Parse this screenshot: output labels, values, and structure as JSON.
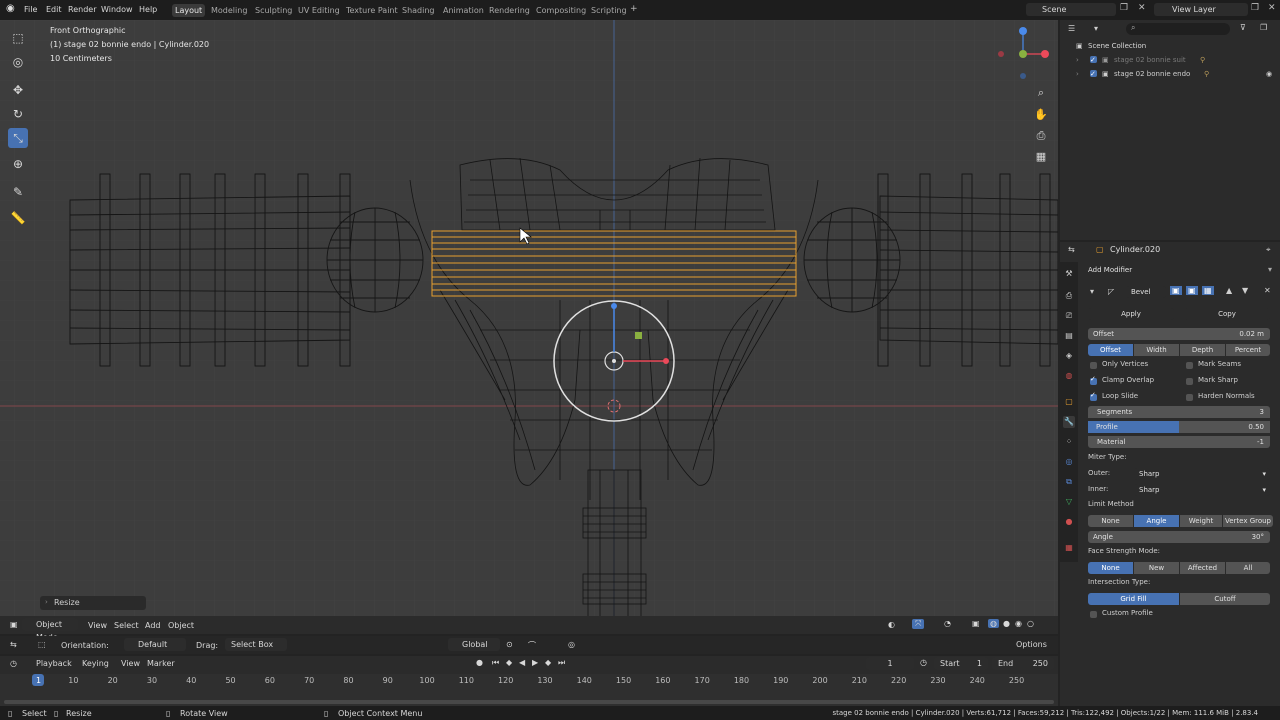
{
  "menu": [
    "File",
    "Edit",
    "Render",
    "Window",
    "Help"
  ],
  "workspaces": [
    "Layout",
    "Modeling",
    "Sculpting",
    "UV Editing",
    "Texture Paint",
    "Shading",
    "Animation",
    "Rendering",
    "Compositing",
    "Scripting"
  ],
  "scene_label": "Scene",
  "view_layer_label": "View Layer",
  "viewport": {
    "view_name": "Front Orthographic",
    "object_info": "(1) stage 02 bonnie endo | Cylinder.020",
    "scale_info": "10 Centimeters",
    "last_op": "Resize"
  },
  "viewport_header": {
    "mode": "Object Mode",
    "view": "View",
    "select": "Select",
    "add": "Add",
    "object": "Object"
  },
  "tool_header": {
    "orientation_label": "Orientation:",
    "orientation_value": "Default",
    "drag_label": "Drag:",
    "drag_value": "Select Box",
    "transform_space": "Global",
    "options": "Options"
  },
  "outliner": {
    "root": "Scene Collection",
    "items": [
      {
        "name": "stage 02 bonnie suit"
      },
      {
        "name": "stage 02 bonnie endo"
      }
    ]
  },
  "properties": {
    "object_name": "Cylinder.020",
    "add_modifier": "Add Modifier",
    "modifier_name": "Bevel",
    "apply": "Apply",
    "copy": "Copy",
    "offset_label": "Offset",
    "offset_value": "0.02 m",
    "width_types": [
      "Offset",
      "Width",
      "Depth",
      "Percent"
    ],
    "only_vertices": "Only Vertices",
    "clamp_overlap": "Clamp Overlap",
    "loop_slide": "Loop Slide",
    "mark_seams": "Mark Seams",
    "mark_sharp": "Mark Sharp",
    "harden_normals": "Harden Normals",
    "segments_label": "Segments",
    "segments_value": "3",
    "profile_label": "Profile",
    "profile_value": "0.50",
    "profile_fraction": 0.5,
    "material_label": "Material",
    "material_value": "-1",
    "miter_type": "Miter Type:",
    "outer_label": "Outer:",
    "outer_value": "Sharp",
    "inner_label": "Inner:",
    "inner_value": "Sharp",
    "limit_method": "Limit Method",
    "limit_options": [
      "None",
      "Angle",
      "Weight",
      "Vertex Group"
    ],
    "angle_label": "Angle",
    "angle_value": "30°",
    "face_strength": "Face Strength Mode:",
    "face_options": [
      "None",
      "New",
      "Affected",
      "All"
    ],
    "intersection_type": "Intersection Type:",
    "intersection_options": [
      "Grid Fill",
      "Cutoff"
    ],
    "custom_profile": "Custom Profile"
  },
  "timeline": {
    "menus": [
      "Playback",
      "Keying",
      "View",
      "Marker"
    ],
    "current_frame": "1",
    "start_label": "Start",
    "start_value": "1",
    "end_label": "End",
    "end_value": "250",
    "ticks": [
      "1",
      "10",
      "20",
      "30",
      "40",
      "50",
      "60",
      "70",
      "80",
      "90",
      "100",
      "110",
      "120",
      "130",
      "140",
      "150",
      "160",
      "170",
      "180",
      "190",
      "200",
      "210",
      "220",
      "230",
      "240",
      "250"
    ]
  },
  "statusbar": {
    "select": "Select",
    "resize": "Resize",
    "rotate_view": "Rotate View",
    "context_menu": "Object Context Menu",
    "stats": "stage 02 bonnie endo | Cylinder.020 | Verts:61,712 | Faces:59,212 | Tris:122,492 | Objects:1/22 | Mem: 111.6 MiB | 2.83.4"
  },
  "colors": {
    "accent": "#4772b3",
    "selection": "#e8a030",
    "viewport_bg": "#3d3d3d",
    "wire": "#111111"
  }
}
